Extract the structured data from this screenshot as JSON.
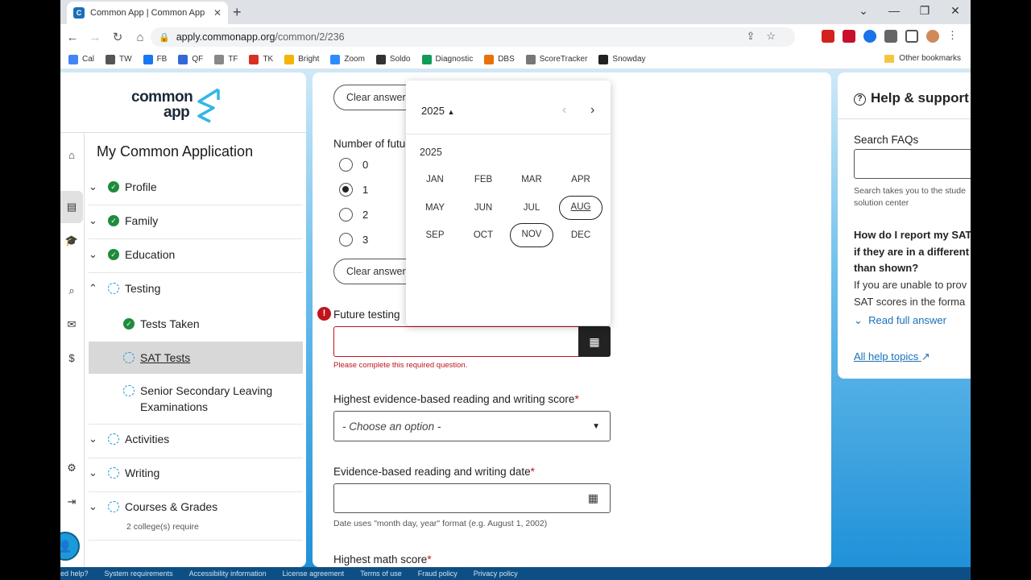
{
  "browser": {
    "tab_title": "Common App | Common App",
    "url_host": "apply.commonapp.org",
    "url_path": "/common/2/236",
    "bookmarks": [
      {
        "label": "Cal",
        "color": "#4285f4"
      },
      {
        "label": "TW",
        "color": "#555555"
      },
      {
        "label": "FB",
        "color": "#1877f2"
      },
      {
        "label": "QF",
        "color": "#3367d6"
      },
      {
        "label": "TF",
        "color": "#888888"
      },
      {
        "label": "TK",
        "color": "#d93025"
      },
      {
        "label": "Bright",
        "color": "#f4b400"
      },
      {
        "label": "Zoom",
        "color": "#2d8cff"
      },
      {
        "label": "Soldo",
        "color": "#333333"
      },
      {
        "label": "Diagnostic",
        "color": "#0f9d58"
      },
      {
        "label": "DBS",
        "color": "#e8710a"
      },
      {
        "label": "ScoreTracker",
        "color": "#777777"
      },
      {
        "label": "Snowday",
        "color": "#222222"
      }
    ],
    "other_bookmarks": "Other bookmarks"
  },
  "logo": {
    "line1": "common",
    "line2": "app"
  },
  "sidebar": {
    "title": "My Common Application",
    "sections": [
      {
        "label": "Profile"
      },
      {
        "label": "Family"
      },
      {
        "label": "Education"
      },
      {
        "label": "Testing"
      },
      {
        "label": "Activities"
      },
      {
        "label": "Writing"
      },
      {
        "label": "Courses & Grades",
        "note": "2 college(s) require"
      }
    ],
    "testing_sub": [
      {
        "label": "Tests Taken"
      },
      {
        "label": "SAT Tests"
      },
      {
        "label": "Senior Secondary Leaving Examinations"
      }
    ]
  },
  "form": {
    "clear_answer": "Clear answer",
    "num_future_label": "Number of future",
    "radio_options": [
      "0",
      "1",
      "2",
      "3"
    ],
    "selected_radio": "1",
    "future_testing_label": "Future testing",
    "error_text": "Please complete this required question.",
    "ebrw_score_label": "Highest evidence-based reading and writing score",
    "select_placeholder": "- Choose an option -",
    "ebrw_date_label": "Evidence-based reading and writing date",
    "date_hint": "Date uses \"month day, year\" format (e.g. August 1, 2002)",
    "math_score_label": "Highest math score",
    "required_mark": "*"
  },
  "date_picker": {
    "year_button": "2025",
    "year_label": "2025",
    "months": [
      "JAN",
      "FEB",
      "MAR",
      "APR",
      "MAY",
      "JUN",
      "JUL",
      "AUG",
      "SEP",
      "OCT",
      "NOV",
      "DEC"
    ],
    "selected_month": "AUG",
    "hovered_month": "NOV"
  },
  "help": {
    "title": "Help & support",
    "search_label": "Search FAQs",
    "search_hint": "Search takes you to the stude\nsolution center",
    "question": "How do I report my SAT\nif they are in a different\nthan shown?",
    "answer": "If you are unable to prov\nSAT scores in the forma",
    "read_full": "Read full answer",
    "all_topics": "All help topics"
  },
  "footer": {
    "links": [
      "ed help?",
      "System requirements",
      "Accessibility information",
      "License agreement",
      "Terms of use",
      "Fraud policy",
      "Privacy policy"
    ]
  }
}
